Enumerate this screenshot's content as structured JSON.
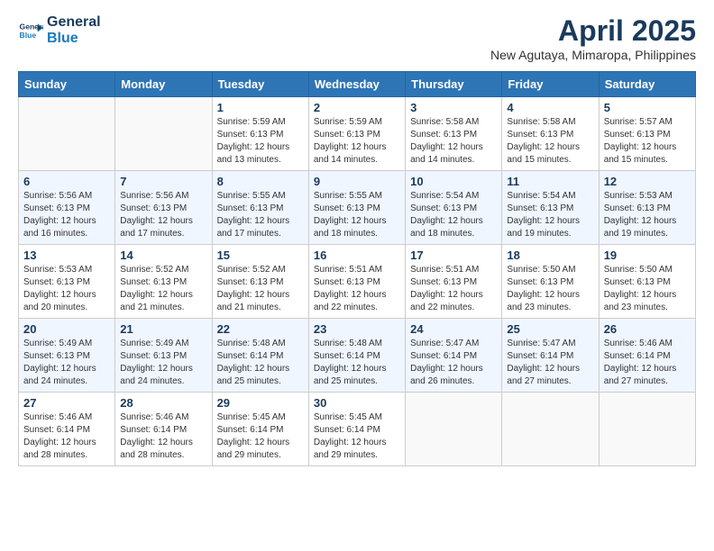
{
  "logo": {
    "line1": "General",
    "line2": "Blue"
  },
  "title": "April 2025",
  "location": "New Agutaya, Mimaropa, Philippines",
  "days_of_week": [
    "Sunday",
    "Monday",
    "Tuesday",
    "Wednesday",
    "Thursday",
    "Friday",
    "Saturday"
  ],
  "weeks": [
    [
      {
        "day": "",
        "info": ""
      },
      {
        "day": "",
        "info": ""
      },
      {
        "day": "1",
        "info": "Sunrise: 5:59 AM\nSunset: 6:13 PM\nDaylight: 12 hours and 13 minutes."
      },
      {
        "day": "2",
        "info": "Sunrise: 5:59 AM\nSunset: 6:13 PM\nDaylight: 12 hours and 14 minutes."
      },
      {
        "day": "3",
        "info": "Sunrise: 5:58 AM\nSunset: 6:13 PM\nDaylight: 12 hours and 14 minutes."
      },
      {
        "day": "4",
        "info": "Sunrise: 5:58 AM\nSunset: 6:13 PM\nDaylight: 12 hours and 15 minutes."
      },
      {
        "day": "5",
        "info": "Sunrise: 5:57 AM\nSunset: 6:13 PM\nDaylight: 12 hours and 15 minutes."
      }
    ],
    [
      {
        "day": "6",
        "info": "Sunrise: 5:56 AM\nSunset: 6:13 PM\nDaylight: 12 hours and 16 minutes."
      },
      {
        "day": "7",
        "info": "Sunrise: 5:56 AM\nSunset: 6:13 PM\nDaylight: 12 hours and 17 minutes."
      },
      {
        "day": "8",
        "info": "Sunrise: 5:55 AM\nSunset: 6:13 PM\nDaylight: 12 hours and 17 minutes."
      },
      {
        "day": "9",
        "info": "Sunrise: 5:55 AM\nSunset: 6:13 PM\nDaylight: 12 hours and 18 minutes."
      },
      {
        "day": "10",
        "info": "Sunrise: 5:54 AM\nSunset: 6:13 PM\nDaylight: 12 hours and 18 minutes."
      },
      {
        "day": "11",
        "info": "Sunrise: 5:54 AM\nSunset: 6:13 PM\nDaylight: 12 hours and 19 minutes."
      },
      {
        "day": "12",
        "info": "Sunrise: 5:53 AM\nSunset: 6:13 PM\nDaylight: 12 hours and 19 minutes."
      }
    ],
    [
      {
        "day": "13",
        "info": "Sunrise: 5:53 AM\nSunset: 6:13 PM\nDaylight: 12 hours and 20 minutes."
      },
      {
        "day": "14",
        "info": "Sunrise: 5:52 AM\nSunset: 6:13 PM\nDaylight: 12 hours and 21 minutes."
      },
      {
        "day": "15",
        "info": "Sunrise: 5:52 AM\nSunset: 6:13 PM\nDaylight: 12 hours and 21 minutes."
      },
      {
        "day": "16",
        "info": "Sunrise: 5:51 AM\nSunset: 6:13 PM\nDaylight: 12 hours and 22 minutes."
      },
      {
        "day": "17",
        "info": "Sunrise: 5:51 AM\nSunset: 6:13 PM\nDaylight: 12 hours and 22 minutes."
      },
      {
        "day": "18",
        "info": "Sunrise: 5:50 AM\nSunset: 6:13 PM\nDaylight: 12 hours and 23 minutes."
      },
      {
        "day": "19",
        "info": "Sunrise: 5:50 AM\nSunset: 6:13 PM\nDaylight: 12 hours and 23 minutes."
      }
    ],
    [
      {
        "day": "20",
        "info": "Sunrise: 5:49 AM\nSunset: 6:13 PM\nDaylight: 12 hours and 24 minutes."
      },
      {
        "day": "21",
        "info": "Sunrise: 5:49 AM\nSunset: 6:13 PM\nDaylight: 12 hours and 24 minutes."
      },
      {
        "day": "22",
        "info": "Sunrise: 5:48 AM\nSunset: 6:14 PM\nDaylight: 12 hours and 25 minutes."
      },
      {
        "day": "23",
        "info": "Sunrise: 5:48 AM\nSunset: 6:14 PM\nDaylight: 12 hours and 25 minutes."
      },
      {
        "day": "24",
        "info": "Sunrise: 5:47 AM\nSunset: 6:14 PM\nDaylight: 12 hours and 26 minutes."
      },
      {
        "day": "25",
        "info": "Sunrise: 5:47 AM\nSunset: 6:14 PM\nDaylight: 12 hours and 27 minutes."
      },
      {
        "day": "26",
        "info": "Sunrise: 5:46 AM\nSunset: 6:14 PM\nDaylight: 12 hours and 27 minutes."
      }
    ],
    [
      {
        "day": "27",
        "info": "Sunrise: 5:46 AM\nSunset: 6:14 PM\nDaylight: 12 hours and 28 minutes."
      },
      {
        "day": "28",
        "info": "Sunrise: 5:46 AM\nSunset: 6:14 PM\nDaylight: 12 hours and 28 minutes."
      },
      {
        "day": "29",
        "info": "Sunrise: 5:45 AM\nSunset: 6:14 PM\nDaylight: 12 hours and 29 minutes."
      },
      {
        "day": "30",
        "info": "Sunrise: 5:45 AM\nSunset: 6:14 PM\nDaylight: 12 hours and 29 minutes."
      },
      {
        "day": "",
        "info": ""
      },
      {
        "day": "",
        "info": ""
      },
      {
        "day": "",
        "info": ""
      }
    ]
  ]
}
